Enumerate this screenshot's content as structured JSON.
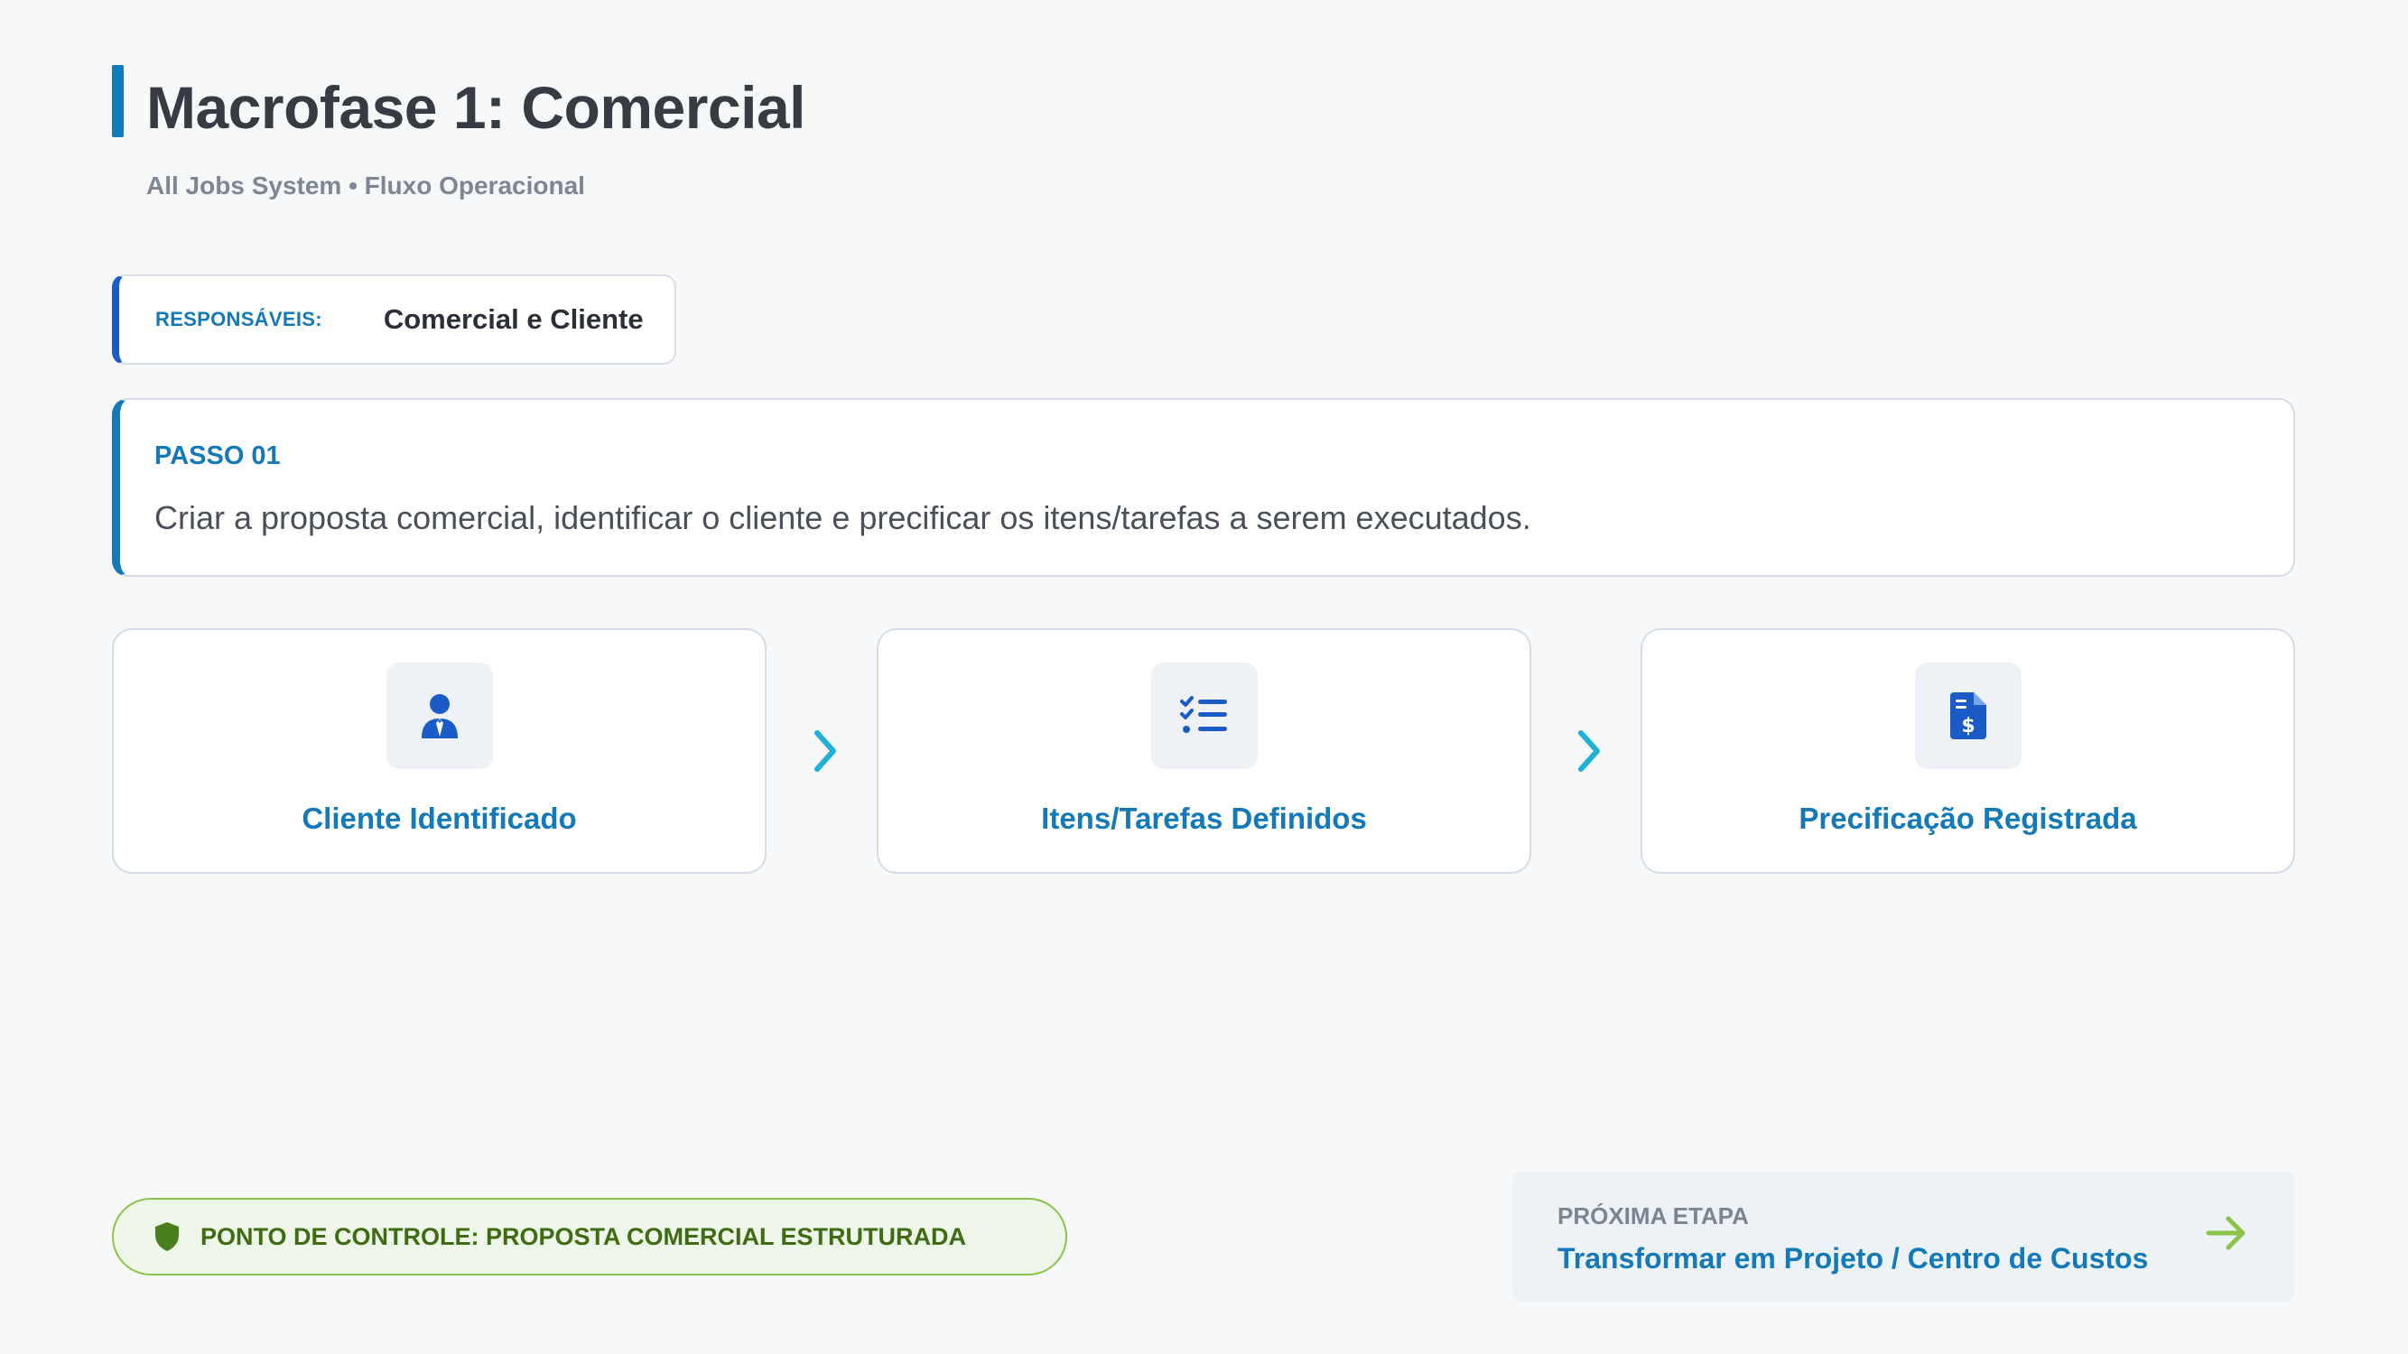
{
  "header": {
    "title": "Macrofase 1: Comercial",
    "subtitle": "All Jobs System • Fluxo Operacional"
  },
  "responsaveis": {
    "label": "RESPONSÁVEIS:",
    "value": "Comercial e Cliente"
  },
  "step": {
    "label": "PASSO 01",
    "description": "Criar a proposta comercial, identificar o cliente e precificar os itens/tarefas a serem executados."
  },
  "flow": [
    {
      "icon": "user-tie-icon",
      "label": "Cliente Identificado"
    },
    {
      "icon": "checklist-icon",
      "label": "Itens/Tarefas Definidos"
    },
    {
      "icon": "invoice-dollar-icon",
      "label": "Precificação Registrada"
    }
  ],
  "checkpoint": {
    "icon": "shield-icon",
    "text": "PONTO DE CONTROLE: PROPOSTA COMERCIAL ESTRUTURADA"
  },
  "next_step": {
    "label": "PRÓXIMA ETAPA",
    "value": "Transformar em Projeto / Centro de Custos",
    "icon": "arrow-right-icon"
  },
  "colors": {
    "primary": "#1479b8",
    "accent_blue": "#1a5bc8",
    "chevron": "#1fb0d6",
    "success": "#8cc34a",
    "success_text": "#3f6b12",
    "background": "#f6f8fa"
  }
}
